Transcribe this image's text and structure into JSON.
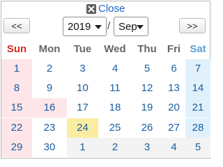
{
  "close": {
    "label": "Close",
    "icon": "close-icon"
  },
  "nav": {
    "prev_label": "<<",
    "next_label": ">>",
    "separator": "/"
  },
  "year_select": {
    "value": "2019"
  },
  "month_select": {
    "value": "Sep"
  },
  "weekdays": [
    "Sun",
    "Mon",
    "Tue",
    "Wed",
    "Thu",
    "Fri",
    "Sat"
  ],
  "weeks": [
    [
      "1",
      "2",
      "3",
      "4",
      "5",
      "6",
      "7"
    ],
    [
      "8",
      "9",
      "10",
      "11",
      "12",
      "13",
      "14"
    ],
    [
      "15",
      "16",
      "17",
      "18",
      "19",
      "20",
      "21"
    ],
    [
      "22",
      "23",
      "24",
      "25",
      "26",
      "27",
      "28"
    ],
    [
      "29",
      "30",
      "1",
      "2",
      "3",
      "4",
      "5"
    ]
  ],
  "today": "24",
  "colors": {
    "sunday_text": "#d62a20",
    "saturday_text": "#5aa0d8",
    "day_text": "#1a5fa3",
    "sunday_bg": "#fde5e9",
    "saturday_bg": "#e1f1fc",
    "today_bg": "#faeda2",
    "other_month_bg": "#f3f3f3",
    "link": "#1e64c8"
  }
}
